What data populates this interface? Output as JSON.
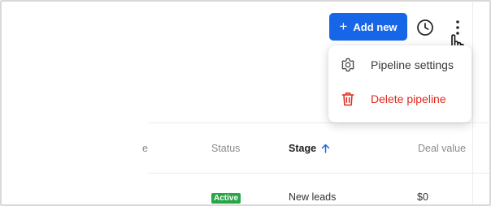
{
  "header": {
    "add_new_label": "Add new",
    "add_new_color": "#1766e8"
  },
  "menu": {
    "items": [
      {
        "label": "Pipeline settings",
        "icon": "gear-icon"
      },
      {
        "label": "Delete pipeline",
        "icon": "trash-icon",
        "color": "#e0281c"
      }
    ]
  },
  "table": {
    "columns": [
      {
        "label": "e"
      },
      {
        "label": "Status"
      },
      {
        "label": "Stage",
        "sorted": "ascending"
      },
      {
        "label": "Deal value"
      }
    ],
    "rows": [
      {
        "status": "Active",
        "stage": "New leads",
        "deal_value": "$0"
      }
    ],
    "status_color": "#27a645"
  }
}
